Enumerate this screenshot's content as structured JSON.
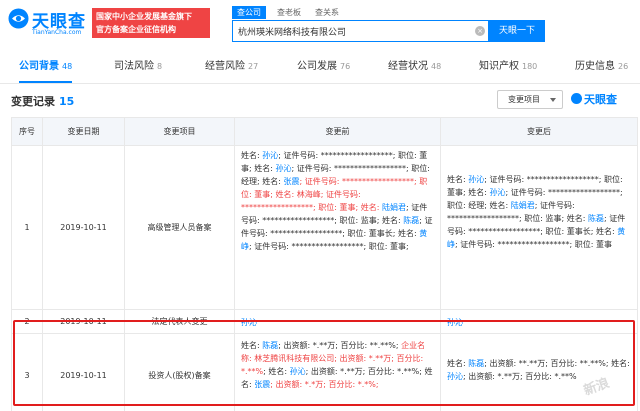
{
  "header": {
    "logo_title": "天眼查",
    "logo_sub": "TianYanCha.com",
    "slogan_line1": "国家中小企业发展基金旗下",
    "slogan_line2": "官方备案企业征信机构",
    "search_tabs": [
      "查公司",
      "查老板",
      "查关系"
    ],
    "search_value": "杭州瑛米网络科技有限公司",
    "search_button": "天眼一下"
  },
  "nav": {
    "tabs": [
      {
        "label": "公司背景",
        "count": "48"
      },
      {
        "label": "司法风险",
        "count": "8"
      },
      {
        "label": "经营风险",
        "count": "27"
      },
      {
        "label": "公司发展",
        "count": "76"
      },
      {
        "label": "经营状况",
        "count": "48"
      },
      {
        "label": "知识产权",
        "count": "180"
      },
      {
        "label": "历史信息",
        "count": "26"
      }
    ]
  },
  "section": {
    "title": "变更记录",
    "count": "15",
    "filter_label": "变更项目",
    "watermark_logo": "天眼查"
  },
  "table": {
    "headers": [
      "序号",
      "变更日期",
      "变更项目",
      "变更前",
      "变更后"
    ],
    "rows": [
      {
        "no": "1",
        "date": "2019-10-11",
        "item": "高级管理人员备案",
        "before": [
          {
            "t": "姓名: ",
            "c": "dark"
          },
          {
            "t": "孙沁",
            "c": "link"
          },
          {
            "t": "; 证件号码: ******************; 职位: 董事; 姓名: ",
            "c": "dark"
          },
          {
            "t": "孙沁",
            "c": "link"
          },
          {
            "t": "; 证件号码: ******************; 职位: 经理; 姓名: ",
            "c": "dark"
          },
          {
            "t": "张震",
            "c": "link"
          },
          {
            "t": "; 证件号码: ******************; 职位: 董事; 姓名: 林海峰; 证件号码: ******************; 职位: 董事; 姓名: ",
            "c": "red"
          },
          {
            "t": "陆娟君",
            "c": "link"
          },
          {
            "t": "; 证件号码: ******************; 职位: 监事; 姓名: ",
            "c": "dark"
          },
          {
            "t": "陈磊",
            "c": "link"
          },
          {
            "t": "; 证件号码: ******************; 职位: 董事长; 姓名: ",
            "c": "dark"
          },
          {
            "t": "黄峥",
            "c": "link"
          },
          {
            "t": "; 证件号码: ******************; 职位: 董事;",
            "c": "dark"
          }
        ],
        "after": [
          {
            "t": "姓名: ",
            "c": "dark"
          },
          {
            "t": "孙沁",
            "c": "link"
          },
          {
            "t": "; 证件号码: ******************; 职位: 董事; 姓名: ",
            "c": "dark"
          },
          {
            "t": "孙沁",
            "c": "link"
          },
          {
            "t": "; 证件号码: ******************; 职位: 经理; 姓名: ",
            "c": "dark"
          },
          {
            "t": "陆娟君",
            "c": "link"
          },
          {
            "t": "; 证件号码: ******************; 职位: 监事; 姓名: ",
            "c": "dark"
          },
          {
            "t": "陈磊",
            "c": "link"
          },
          {
            "t": "; 证件号码: ******************; 职位: 董事长; 姓名: ",
            "c": "dark"
          },
          {
            "t": "黄峥",
            "c": "link"
          },
          {
            "t": "; 证件号码: ******************; 职位: 董事",
            "c": "dark"
          }
        ]
      },
      {
        "no": "2",
        "date": "2019-10-11",
        "item": "法定代表人变更",
        "before": [
          {
            "t": "孙沁",
            "c": "link"
          }
        ],
        "after": [
          {
            "t": "孙沁",
            "c": "link"
          }
        ]
      },
      {
        "no": "3",
        "date": "2019-10-11",
        "item": "投资人(股权)备案",
        "before": [
          {
            "t": "姓名: ",
            "c": "dark"
          },
          {
            "t": "陈磊",
            "c": "link"
          },
          {
            "t": "; 出资额: *.**万; 百分比: **.**%; ",
            "c": "dark"
          },
          {
            "t": "企业名称: 林芝腾讯科技有限公司; 出资额: *.**万; 百分比: *.**%",
            "c": "red"
          },
          {
            "t": "; 姓名: ",
            "c": "dark"
          },
          {
            "t": "孙沁",
            "c": "link"
          },
          {
            "t": "; 出资额: *.**万; 百分比: *.**%; 姓名: ",
            "c": "dark"
          },
          {
            "t": "张震",
            "c": "link"
          },
          {
            "t": "; 出资额: *.*万; 百分比: *.*%;",
            "c": "red"
          }
        ],
        "after": [
          {
            "t": "姓名: ",
            "c": "dark"
          },
          {
            "t": "陈磊",
            "c": "link"
          },
          {
            "t": "; 出资额: **.**万; 百分比: **.**%; 姓名: ",
            "c": "dark"
          },
          {
            "t": "孙沁",
            "c": "link"
          },
          {
            "t": "; 出资额: *.**万; 百分比: *.**%",
            "c": "dark"
          }
        ]
      }
    ]
  },
  "colors": {
    "accent": "#0084ff",
    "alert": "#ef4444",
    "highlight_border": "#e11d1d"
  }
}
